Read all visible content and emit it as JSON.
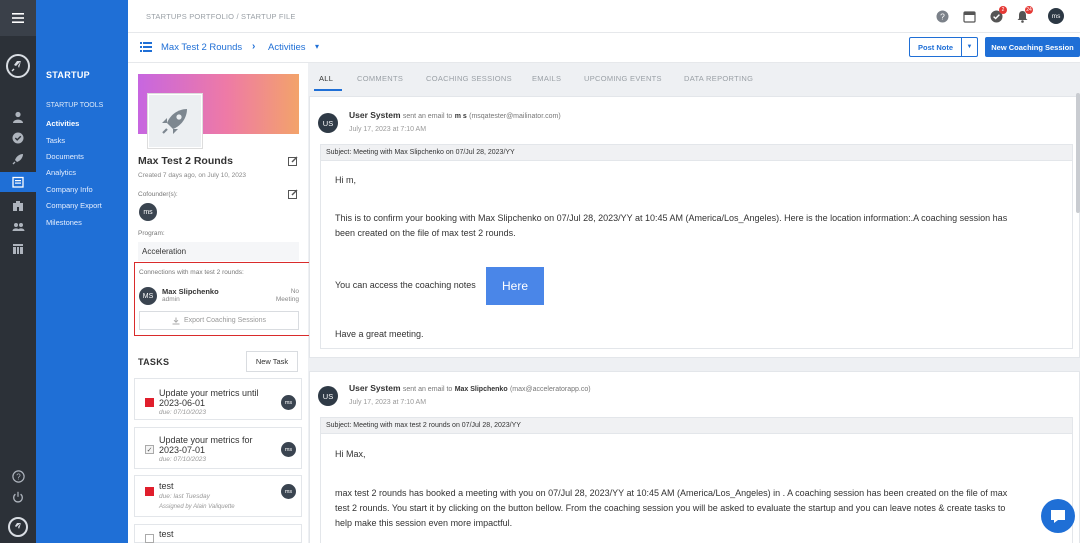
{
  "sidebar": {
    "title": "STARTUP",
    "section": "STARTUP TOOLS",
    "items": [
      "Activities",
      "Tasks",
      "Documents",
      "Analytics",
      "Company Info",
      "Company Export",
      "Milestones"
    ]
  },
  "header": {
    "breadcrumb": "STARTUPS PORTFOLIO  /  STARTUP FILE",
    "badges": {
      "tasks": "2",
      "notifications": "24"
    },
    "user_initials": "ms"
  },
  "subheader": {
    "startup_name": "Max Test 2 Rounds",
    "section": "Activities",
    "post_note": "Post Note",
    "new_session": "New Coaching Session"
  },
  "startup": {
    "name": "Max Test 2 Rounds",
    "created": "Created 7 days ago, on July 10, 2023",
    "cofounders_label": "Cofounder(s):",
    "cofounder_initials": "ms",
    "program_label": "Program:",
    "program": "Acceleration",
    "connections_label": "Connections with max test 2 rounds:",
    "connection": {
      "initials": "MS",
      "name": "Max Slipchenko",
      "role": "admin",
      "status_1": "No",
      "status_2": "Meeting"
    },
    "export_label": "Export Coaching Sessions"
  },
  "tasks": {
    "title": "TASKS",
    "new_label": "New Task",
    "items": [
      {
        "title": "Update your metrics until 2023-06-01",
        "due": "due: 07/10/2023",
        "assigned": "",
        "initials": "ms"
      },
      {
        "title": "Update your metrics for 2023-07-01",
        "due": "due: 07/10/2023",
        "assigned": "",
        "initials": "ms"
      },
      {
        "title": "test",
        "due": "due: last Tuesday",
        "assigned": "Assigned by Alain Valiquette",
        "initials": "ms"
      },
      {
        "title": "test",
        "due": "",
        "assigned": "",
        "initials": ""
      }
    ]
  },
  "tabs": [
    "ALL",
    "COMMENTS",
    "COACHING SESSIONS",
    "EMAILS",
    "UPCOMING EVENTS",
    "DATA REPORTING"
  ],
  "activities": [
    {
      "initials": "US",
      "sender": "User System",
      "action": "sent an email to",
      "recipient": "m s",
      "recipient_email": "(msqatester@mailinator.com)",
      "date": "July 17, 2023 at 7:10 AM",
      "subject": "Subject: Meeting with Max Slipchenko on 07/Jul 28, 2023/YY",
      "greeting": "Hi m,",
      "para1": "This is to confirm your booking with Max Slipchenko on 07/Jul 28, 2023/YY at 10:45 AM (America/Los_Angeles). Here is the location information:.A coaching session has",
      "para1b": "been created on the file of max test 2 rounds.",
      "access_text": "You can access the coaching notes",
      "here_label": "Here",
      "closing": "Have a great meeting."
    },
    {
      "initials": "US",
      "sender": "User System",
      "action": "sent an email to",
      "recipient": "Max Slipchenko",
      "recipient_email": "(max@acceleratorapp.co)",
      "date": "July 17, 2023 at 7:10 AM",
      "subject": "Subject: Meeting with max test 2 rounds on 07/Jul 28, 2023/YY",
      "greeting": "Hi Max,",
      "para1": "max test 2 rounds has booked a meeting with you on 07/Jul 28, 2023/YY at 10:45 AM (America/Los_Angeles) in . A coaching session has been created on the file of max",
      "para1b": "test 2 rounds. You start it by clicking on the button bellow. From the coaching session you will be asked to evaluate the startup and you can leave notes & create tasks to",
      "para1c": "help make this session even more impactful."
    }
  ]
}
